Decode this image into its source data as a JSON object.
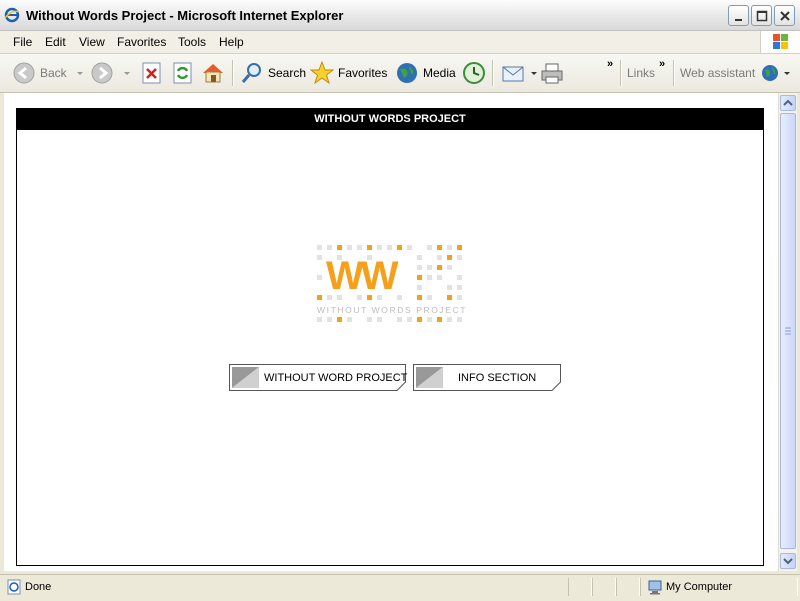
{
  "window": {
    "title": "Without Words Project - Microsoft Internet Explorer"
  },
  "menu": [
    "File",
    "Edit",
    "View",
    "Favorites",
    "Tools",
    "Help"
  ],
  "toolbar": {
    "back": "Back",
    "search": "Search",
    "favorites": "Favorites",
    "media": "Media",
    "links": "Links",
    "web_assistant": "Web assistant"
  },
  "page": {
    "header": "WITHOUT WORDS PROJECT",
    "logo_letters": "WW",
    "logo_text": "WITHOUT WORDS PROJECT",
    "buttons": [
      "WITHOUT WORD PROJECT",
      "INFO SECTION"
    ]
  },
  "status": {
    "text": "Done",
    "zone": "My Computer"
  },
  "colors": {
    "accent": "#f5a01b",
    "titlebar": "#e6e6e6",
    "header": "#000000"
  }
}
